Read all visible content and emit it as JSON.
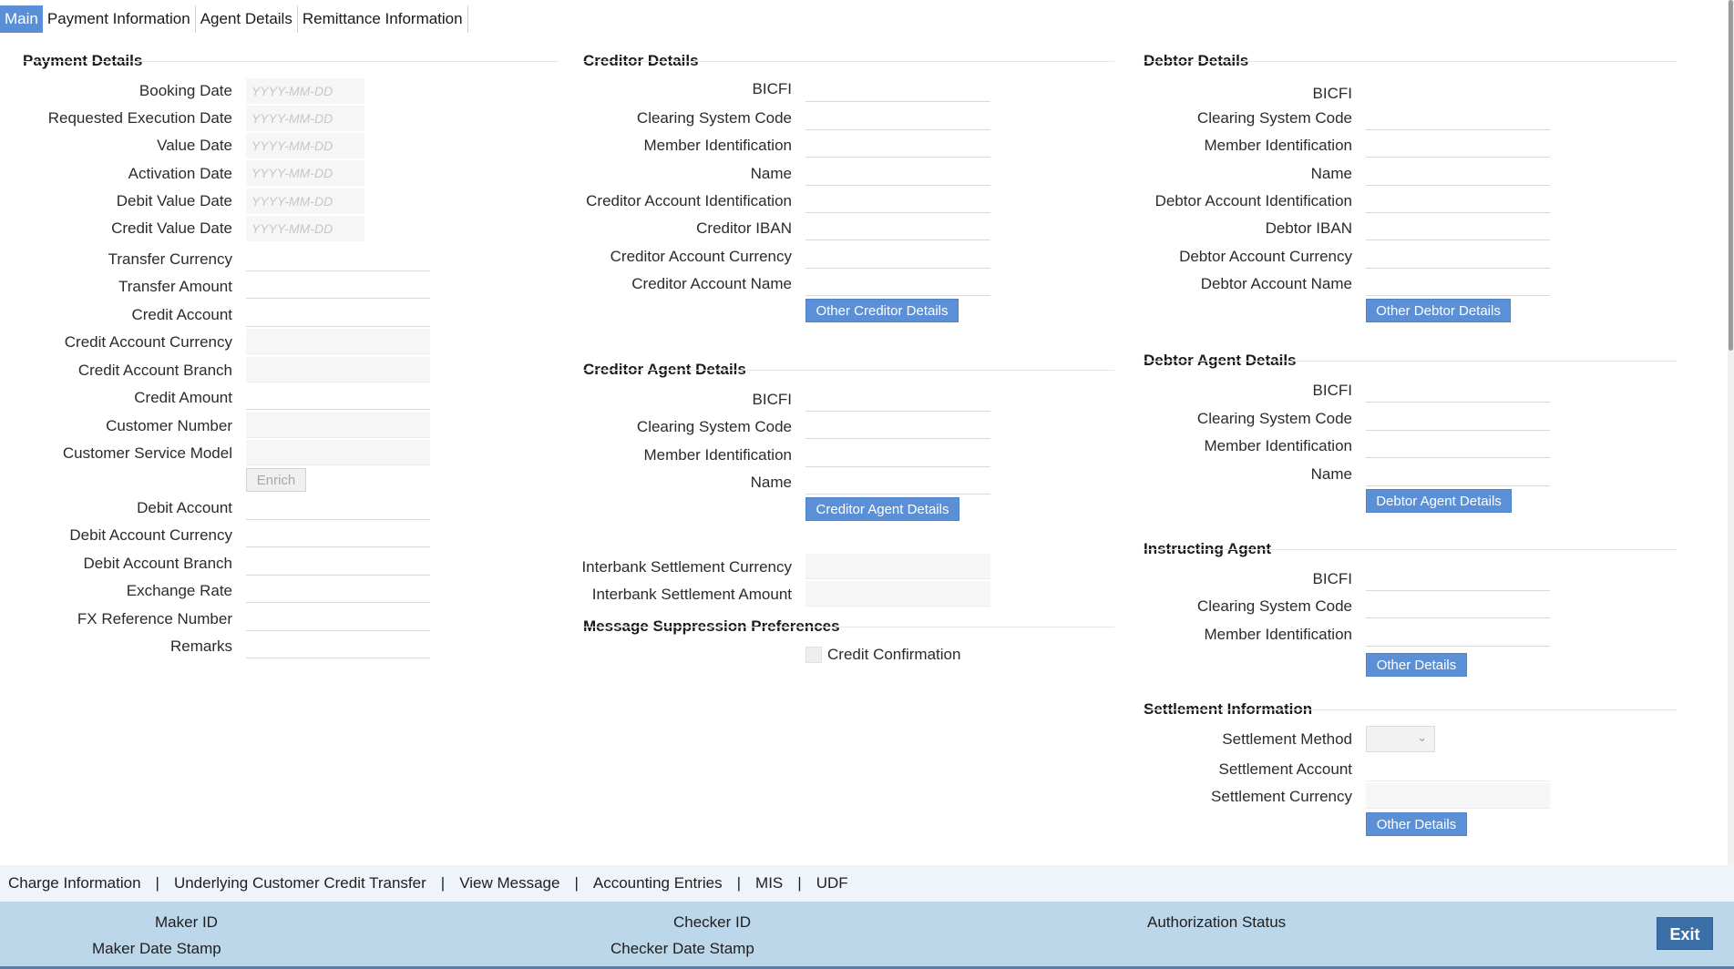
{
  "tabs": [
    "Main",
    "Payment Information",
    "Agent Details",
    "Remittance Information"
  ],
  "payment_details": {
    "title": "Payment Details",
    "date_placeholder": "YYYY-MM-DD",
    "fields": [
      "Booking Date",
      "Requested Execution Date",
      "Value Date",
      "Activation Date",
      "Debit Value Date",
      "Credit Value Date",
      "Transfer Currency",
      "Transfer Amount",
      "Credit Account",
      "Credit Account Currency",
      "Credit Account Branch",
      "Credit Amount",
      "Customer Number",
      "Customer Service Model",
      "Debit Account",
      "Debit Account Currency",
      "Debit Account Branch",
      "Exchange Rate",
      "FX Reference Number",
      "Remarks"
    ],
    "enrich_button": "Enrich"
  },
  "creditor_details": {
    "title": "Creditor Details",
    "fields": [
      "BICFI",
      "Clearing System Code",
      "Member Identification",
      "Name",
      "Creditor Account Identification",
      "Creditor IBAN",
      "Creditor Account Currency",
      "Creditor Account Name"
    ],
    "button": "Other Creditor Details"
  },
  "creditor_agent_details": {
    "title": "Creditor Agent Details",
    "fields": [
      "BICFI",
      "Clearing System Code",
      "Member Identification",
      "Name"
    ],
    "button": "Creditor Agent Details",
    "settlement_fields": [
      "Interbank Settlement Currency",
      "Interbank Settlement Amount"
    ]
  },
  "message_suppression": {
    "title": "Message Suppression Preferences",
    "checkbox_label": "Credit Confirmation"
  },
  "debtor_details": {
    "title": "Debtor Details",
    "fields": [
      "BICFI",
      "Clearing System Code",
      "Member Identification",
      "Name",
      "Debtor Account Identification",
      "Debtor IBAN",
      "Debtor Account Currency",
      "Debtor Account Name"
    ],
    "button": "Other Debtor Details"
  },
  "debtor_agent_details": {
    "title": "Debtor Agent Details",
    "fields": [
      "BICFI",
      "Clearing System Code",
      "Member Identification",
      "Name"
    ],
    "button": "Debtor Agent Details"
  },
  "instructing_agent": {
    "title": "Instructing Agent",
    "fields": [
      "BICFI",
      "Clearing System Code",
      "Member Identification"
    ],
    "button": "Other Details"
  },
  "settlement_information": {
    "title": "Settlement Information",
    "fields": [
      "Settlement Method",
      "Settlement Account",
      "Settlement Currency"
    ],
    "button": "Other Details"
  },
  "bottom_links": [
    "Charge Information",
    "Underlying Customer Credit Transfer",
    "View Message",
    "Accounting Entries",
    "MIS",
    "UDF"
  ],
  "link_separator": "|",
  "footer": {
    "maker_id": "Maker ID",
    "maker_date_stamp": "Maker Date Stamp",
    "checker_id": "Checker ID",
    "checker_date_stamp": "Checker Date Stamp",
    "authorization_status": "Authorization Status",
    "exit_button": "Exit"
  },
  "colors": {
    "accent": "#5c90d6",
    "footer_bg": "#bcd6ea",
    "exit_button": "#3a6fa8"
  }
}
